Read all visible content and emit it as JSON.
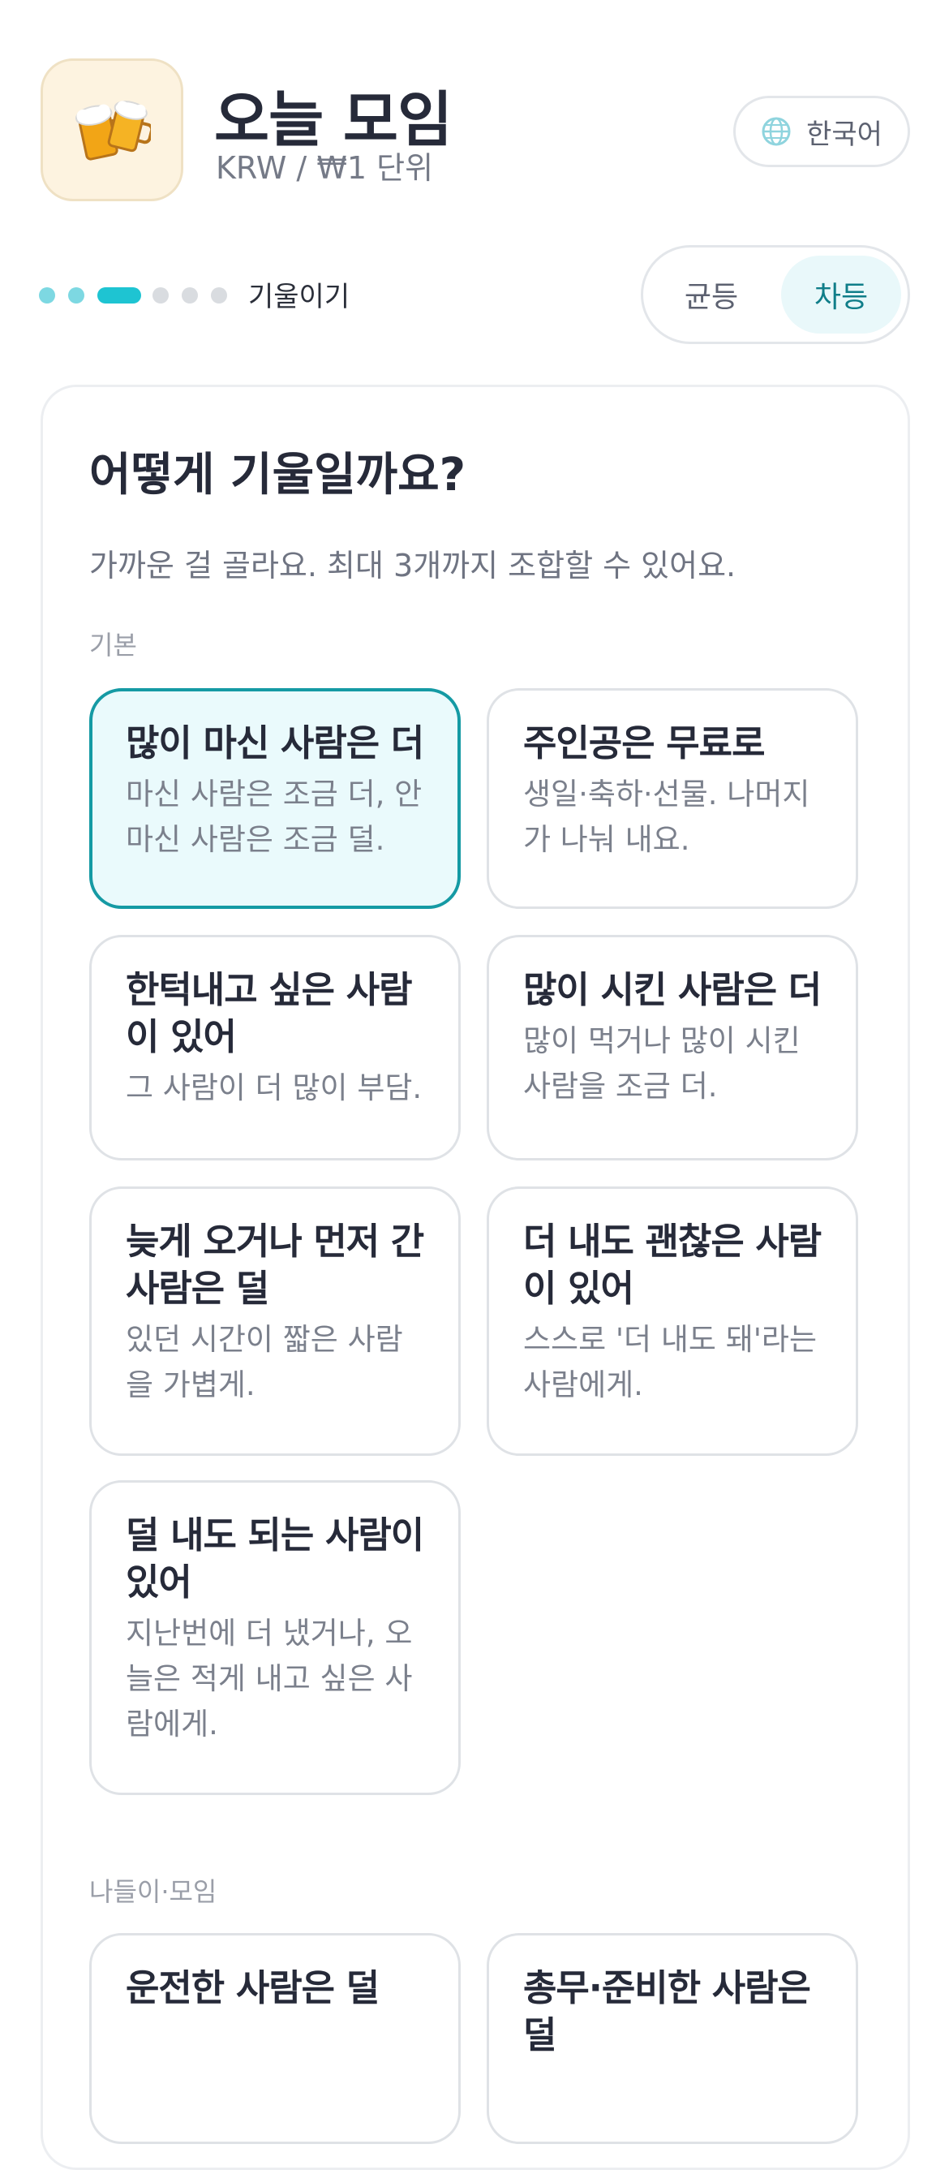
{
  "header": {
    "title": "오늘 모임",
    "subtitle": "KRW / ₩1 단위",
    "app_icon": "beer-mugs-icon",
    "language_label": "한국어",
    "language_icon": "globe-icon"
  },
  "steps": {
    "total": 6,
    "current": 3,
    "label": "기울이기"
  },
  "split_mode": {
    "options": [
      "균등",
      "차등"
    ],
    "selected": "차등"
  },
  "question": {
    "title": "어떻게 기울일까요?",
    "description": "가까운 걸 골라요. 최대 3개까지 조합할 수 있어요."
  },
  "sections": [
    {
      "label": "기본",
      "options": [
        {
          "title": "많이 마신 사람은 더",
          "desc": "마신 사람은 조금 더, 안 마신 사람은 조금 덜.",
          "selected": true
        },
        {
          "title": "주인공은 무료로",
          "desc": "생일·축하·선물. 나머지가 나눠 내요.",
          "selected": false
        },
        {
          "title": "한턱내고 싶은 사람이 있어",
          "desc": "그 사람이 더 많이 부담.",
          "selected": false
        },
        {
          "title": "많이 시킨 사람은 더",
          "desc": "많이 먹거나 많이 시킨 사람을 조금 더.",
          "selected": false
        },
        {
          "title": "늦게 오거나 먼저 간 사람은 덜",
          "desc": "있던 시간이 짧은 사람을 가볍게.",
          "selected": false
        },
        {
          "title": "더 내도 괜찮은 사람이 있어",
          "desc": "스스로 '더 내도 돼'라는 사람에게.",
          "selected": false
        },
        {
          "title": "덜 내도 되는 사람이 있어",
          "desc": "지난번에 더 냈거나, 오늘은 적게 내고 싶은 사람에게.",
          "selected": false
        }
      ]
    },
    {
      "label": "나들이·모임",
      "options": [
        {
          "title": "운전한 사람은 덜",
          "desc": "",
          "selected": false
        },
        {
          "title": "총무·준비한 사람은 덜",
          "desc": "",
          "selected": false
        }
      ]
    }
  ],
  "colors": {
    "accent": "#1ec4d2",
    "selected_border": "#159aa4",
    "selected_bg": "#eafafc"
  }
}
